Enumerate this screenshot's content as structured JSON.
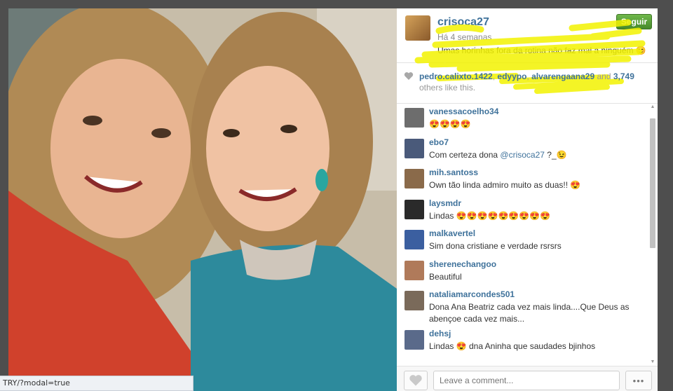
{
  "post": {
    "username": "crisoca27",
    "time": "Há 4 semanas",
    "caption": "Umas horinhas fora da rotina não faz mal a ninguém 😊",
    "follow_label": "Seguir"
  },
  "likes": {
    "users": [
      "pedro.calixto.1422",
      "edyypo",
      "alvarengaana29"
    ],
    "sep": ", ",
    "and_text": " and ",
    "count": "3,749",
    "suffix": "others like this."
  },
  "comments": [
    {
      "user": "vanessacoelho34",
      "text": "😍😍😍😍",
      "avatar_color": "#6d6d6d"
    },
    {
      "user": "ebo7",
      "text_before": "Com certeza dona ",
      "mention": "@crisoca27",
      "text_after": " ?_😉",
      "avatar_color": "#4a5a7a"
    },
    {
      "user": "mih.santoss",
      "text": "Own tão linda admiro muito as duas!! 😍",
      "avatar_color": "#8a6a4a"
    },
    {
      "user": "laysmdr",
      "text": "Lindas 😍😍😍😍😍😍😍😍😍",
      "avatar_color": "#2a2a2a"
    },
    {
      "user": "malkavertel",
      "text": "Sim dona cristiane e verdade rsrsrs",
      "avatar_color": "#3b5fa0"
    },
    {
      "user": "sherenechangoo",
      "text": "Beautiful",
      "avatar_color": "#b07a5a"
    },
    {
      "user": "nataliamarcondes501",
      "text": "Dona Ana Beatriz cada vez mais linda....Que Deus as abençoe cada vez mais...",
      "avatar_color": "#7a6a5a"
    },
    {
      "user": "dehsj",
      "text": "Lindas 😍 dna Aninha que saudades bjinhos",
      "avatar_color": "#5a6a8a"
    }
  ],
  "footer": {
    "comment_placeholder": "Leave a comment...",
    "more_label": "•••"
  },
  "statusbar": {
    "text": "TRY/?modal=true"
  },
  "colors": {
    "link": "#3f729b",
    "follow_green": "#5ca03a",
    "highlight_yellow": "#f2f200"
  }
}
